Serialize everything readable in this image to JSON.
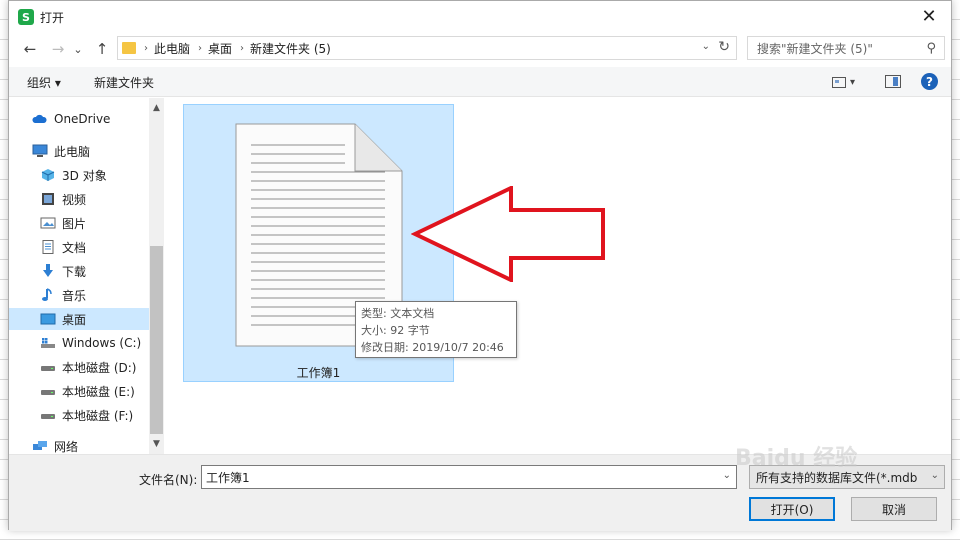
{
  "window": {
    "app_icon": "S",
    "title": "打开",
    "close_glyph": "✕"
  },
  "nav": {
    "back": "←",
    "forward": "→",
    "down": "⌄",
    "up": "↑",
    "crumbs": [
      "此电脑",
      "桌面",
      "新建文件夹 (5)"
    ],
    "crumb_sep": "›",
    "addr_dropdown": "⌄",
    "refresh": "↻"
  },
  "search": {
    "placeholder": "搜索\"新建文件夹 (5)\"",
    "icon_glyph": "⚲"
  },
  "toolbar": {
    "organize": "组织 ▾",
    "new_folder": "新建文件夹",
    "view_arrow": "▾",
    "help": "?"
  },
  "sidebar": {
    "items": [
      {
        "label": "OneDrive",
        "icon": "cloud-icon"
      },
      {
        "label": "此电脑",
        "icon": "computer-icon"
      },
      {
        "label": "3D 对象",
        "icon": "cube-icon"
      },
      {
        "label": "视频",
        "icon": "video-icon"
      },
      {
        "label": "图片",
        "icon": "picture-icon"
      },
      {
        "label": "文档",
        "icon": "document-icon"
      },
      {
        "label": "下载",
        "icon": "download-icon"
      },
      {
        "label": "音乐",
        "icon": "music-icon"
      },
      {
        "label": "桌面",
        "icon": "desktop-icon",
        "selected": true
      },
      {
        "label": "Windows (C:)",
        "icon": "drive-icon"
      },
      {
        "label": "本地磁盘 (D:)",
        "icon": "drive-icon"
      },
      {
        "label": "本地磁盘 (E:)",
        "icon": "drive-icon"
      },
      {
        "label": "本地磁盘 (F:)",
        "icon": "drive-icon"
      },
      {
        "label": "网络",
        "icon": "network-icon"
      }
    ],
    "scroll_up": "▲",
    "scroll_down": "▼"
  },
  "files": [
    {
      "name": "工作簿1"
    }
  ],
  "tooltip": {
    "type": "类型: 文本文档",
    "size": "大小: 92 字节",
    "modified": "修改日期: 2019/10/7 20:46"
  },
  "bottom": {
    "filename_label": "文件名(N):",
    "filename_value": "工作簿1",
    "filename_drop": "⌄",
    "filetype": "所有支持的数据库文件(*.mdb",
    "filetype_drop": "⌄",
    "open": "打开(O)",
    "cancel": "取消"
  },
  "watermark": "Baidu 经验",
  "colors": {
    "selection": "#cce8ff",
    "arrow": "#e0141e",
    "accent": "#0078d7"
  }
}
